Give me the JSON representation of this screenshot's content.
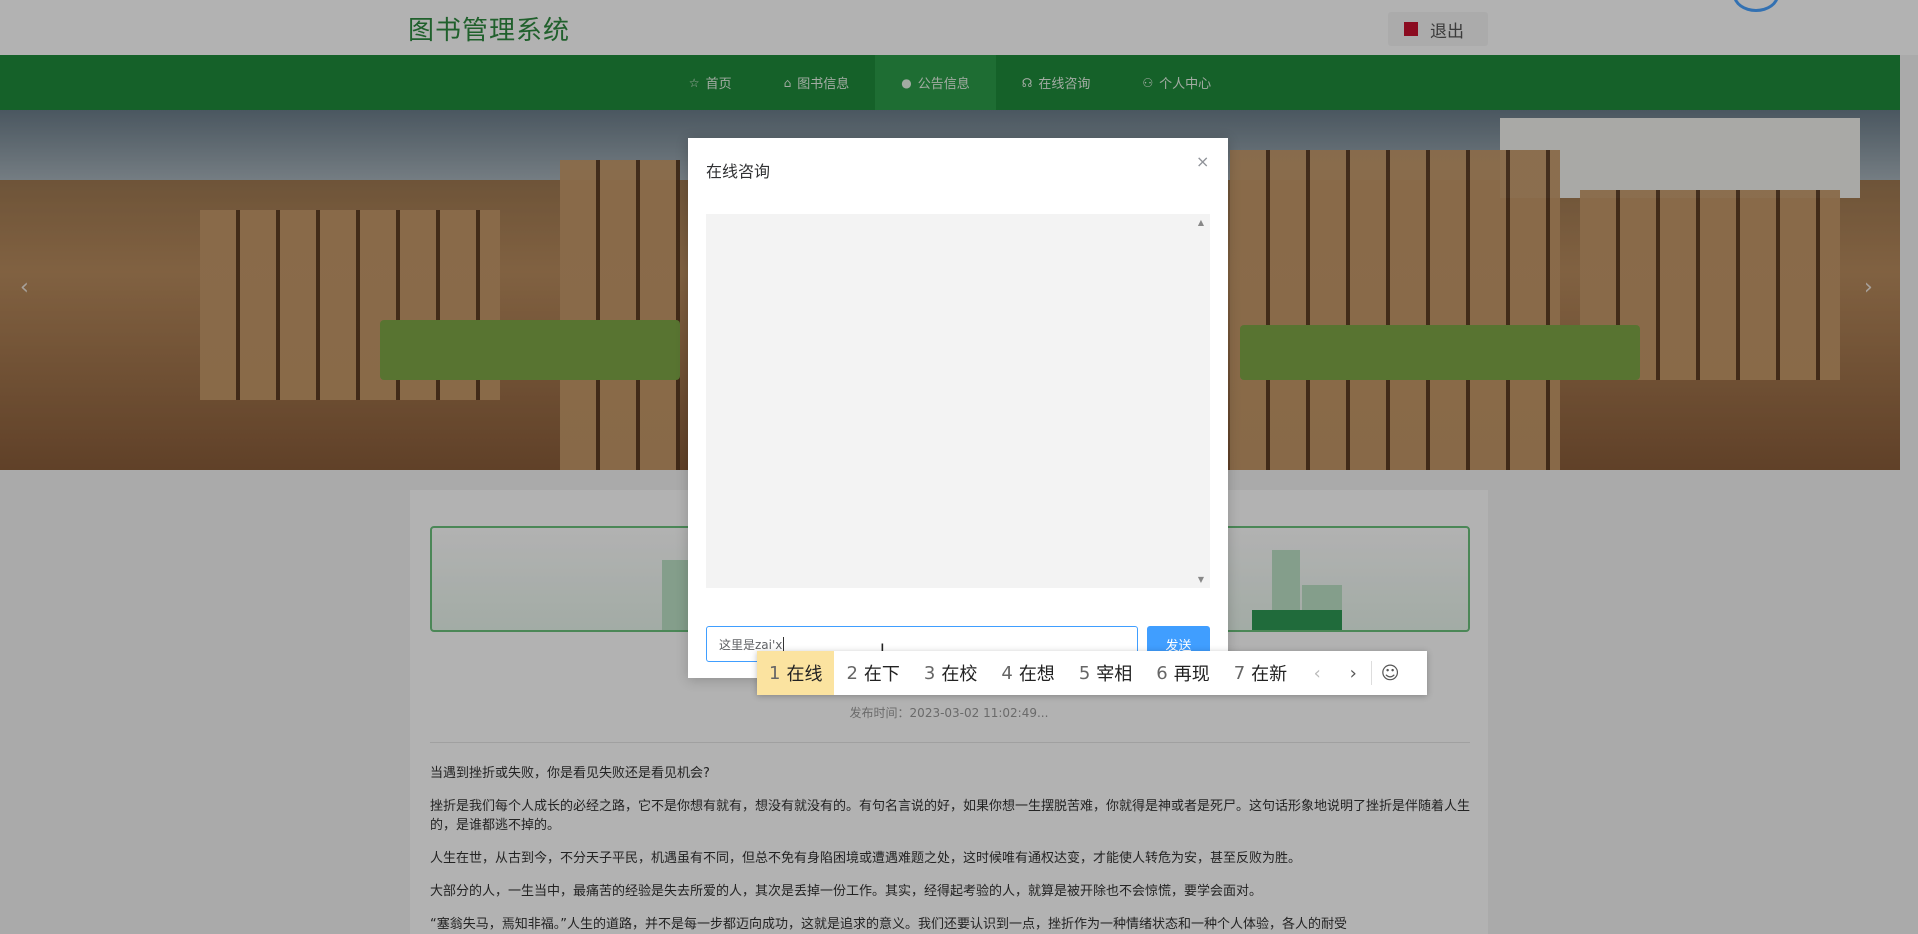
{
  "header": {
    "site_title": "图书管理系统",
    "logout_label": "退出"
  },
  "nav": {
    "items": [
      {
        "icon": "☆",
        "label": "首页"
      },
      {
        "icon": "⌂",
        "label": "图书信息"
      },
      {
        "icon": "●",
        "label": "公告信息"
      },
      {
        "icon": "☊",
        "label": "在线咨询"
      },
      {
        "icon": "⚇",
        "label": "个人中心"
      }
    ],
    "active_index": 2
  },
  "banner": {
    "prev_arrow": "‹",
    "next_arrow": "›"
  },
  "article": {
    "publish_time": "发布时间：2023-03-02 11:02:49...",
    "paragraphs": [
      "当遇到挫折或失败，你是看见失败还是看见机会?",
      "挫折是我们每个人成长的必经之路，它不是你想有就有，想没有就没有的。有句名言说的好，如果你想一生摆脱苦难，你就得是神或者是死尸。这句话形象地说明了挫折是伴随着人生的，是谁都逃不掉的。",
      "人生在世，从古到今，不分天子平民，机遇虽有不同，但总不免有身陷困境或遭遇难题之处，这时候唯有通权达变，才能使人转危为安，甚至反败为胜。",
      "大部分的人，一生当中，最痛苦的经验是失去所爱的人，其次是丢掉一份工作。其实，经得起考验的人，就算是被开除也不会惊慌，要学会面对。",
      "“塞翁失马，焉知非福。”人生的道路，并不是每一步都迈向成功，这就是追求的意义。我们还要认识到一点，挫折作为一种情绪状态和一种个人体验，各人的耐受"
    ]
  },
  "dialog": {
    "title": "在线咨询",
    "close_icon": "×",
    "input_value": "这里是zai'x",
    "send_label": "发送"
  },
  "ime": {
    "candidates": [
      {
        "num": "1",
        "text": "在线"
      },
      {
        "num": "2",
        "text": "在下"
      },
      {
        "num": "3",
        "text": "在校"
      },
      {
        "num": "4",
        "text": "在想"
      },
      {
        "num": "5",
        "text": "宰相"
      },
      {
        "num": "6",
        "text": "再现"
      },
      {
        "num": "7",
        "text": "在新"
      }
    ],
    "prev_page": "‹",
    "next_page": "›",
    "emoji": "☺"
  },
  "colors": {
    "brand_green": "#1f8b3b",
    "accent_blue": "#409eff",
    "ime_highlight": "#fbe3a0"
  }
}
